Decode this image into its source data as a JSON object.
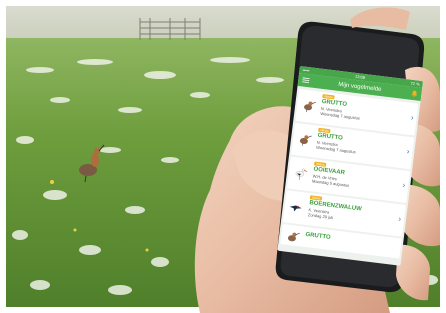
{
  "colors": {
    "accent": "#4caf50",
    "species_text": "#3aa23d",
    "badge": "#f2b21b",
    "chevron": "#2f78c4"
  },
  "status_bar": {
    "left": "•••••",
    "time": "13:08",
    "right": "72 %"
  },
  "app_bar": {
    "title": "Mijn vogelmelde",
    "menu_icon": "hamburger-icon",
    "notification_icon": "bell-icon"
  },
  "sightings": [
    {
      "badge": "Nieuw",
      "species": "GRUTTO",
      "observer": "N. Veenstra",
      "date": "Woensdag 7 augustus",
      "thumbnail": "godwit-icon"
    },
    {
      "badge": "Nieuw",
      "species": "GRUTTO",
      "observer": "N. Veenstra",
      "date": "Woensdag 7 augustus",
      "thumbnail": "godwit-icon"
    },
    {
      "badge": "Nieuw",
      "species": "OOIEVAAR",
      "observer": "W.H. de Vries",
      "date": "Maandag 5 augustus",
      "thumbnail": "stork-icon"
    },
    {
      "badge": "Nieuw",
      "species": "BOERENZWALUW",
      "observer": "K. Veenstra",
      "date": "Zondag 29 juli",
      "thumbnail": "swallow-icon"
    },
    {
      "badge": "",
      "species": "GRUTTO",
      "observer": "",
      "date": "",
      "thumbnail": "godwit-icon"
    }
  ]
}
